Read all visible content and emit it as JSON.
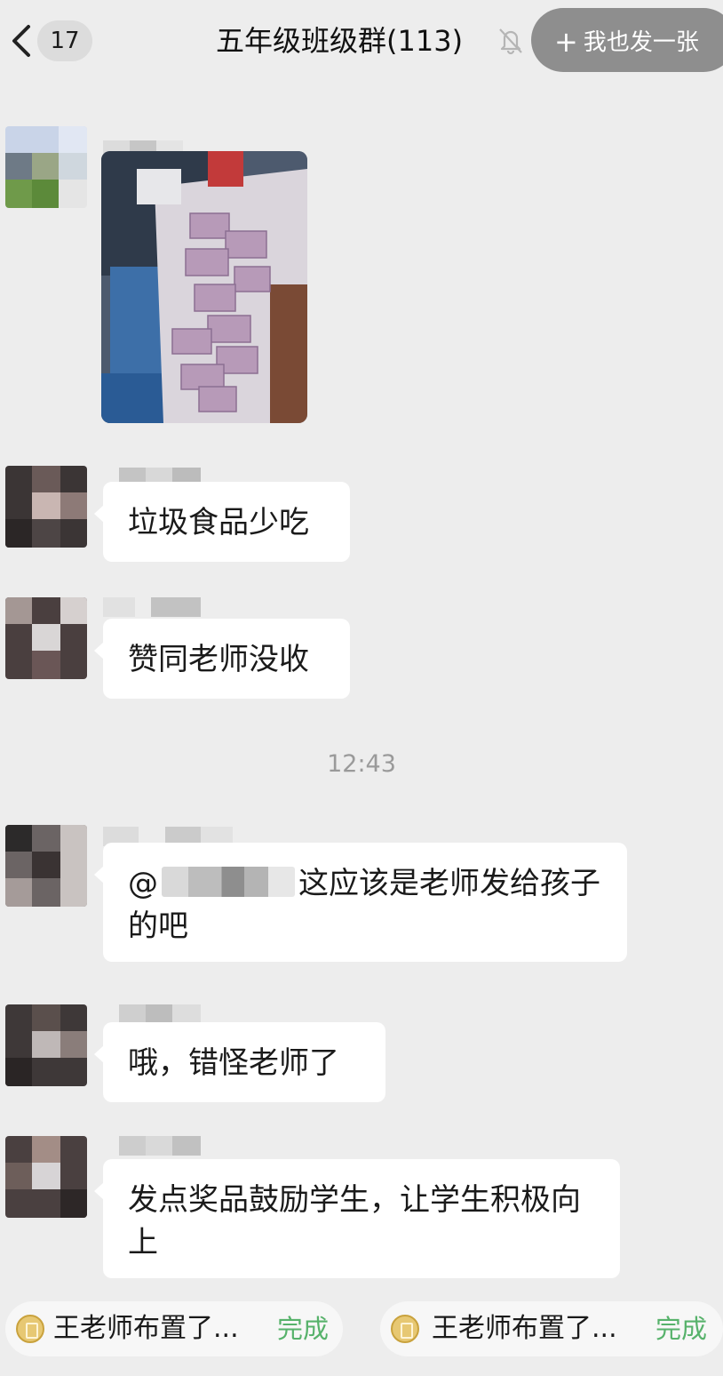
{
  "header": {
    "unread_count": "17",
    "title": "五年级班级群(113)",
    "share_label": "我也发一张"
  },
  "messages": [
    {
      "type": "image",
      "image_name": "photo-of-snack-packets"
    },
    {
      "type": "text",
      "text": "垃圾食品少吃"
    },
    {
      "type": "text",
      "text": "赞同老师没收"
    },
    {
      "type": "timestamp",
      "text": "12:43"
    },
    {
      "type": "text",
      "mention_prefix": "@",
      "text": "这应该是老师发给孩子的吧"
    },
    {
      "type": "text",
      "text": "哦，错怪老师了"
    },
    {
      "type": "text",
      "text": "发点奖品鼓励学生，让学生积极向上"
    }
  ],
  "task_bar": [
    {
      "label": "王老师布置了...",
      "status": "完成"
    },
    {
      "label": "王老师布置了...",
      "status": "完成"
    }
  ],
  "icons": {
    "back": "chevron-left-icon",
    "mute": "bell-off-icon",
    "share": "plus-icon",
    "task": "assignment-icon"
  },
  "colors": {
    "background": "#ededed",
    "bubble": "#ffffff",
    "done_green": "#57b26b",
    "share_button": "#8e8e8e"
  }
}
